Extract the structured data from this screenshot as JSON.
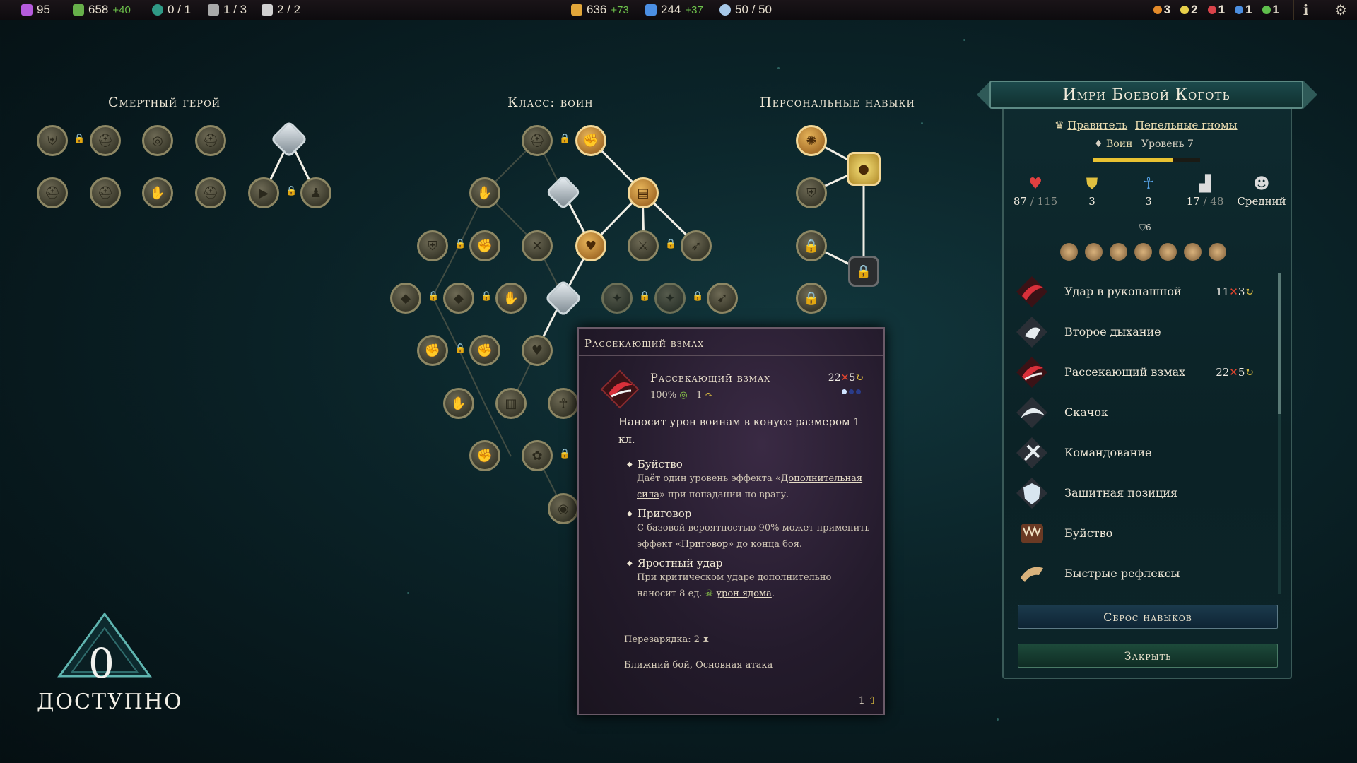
{
  "topbar": {
    "mana": "95",
    "gold_icon_a": "658",
    "gold_a_plus": "+40",
    "portals": "0 / 1",
    "cities": "1 / 3",
    "heroes": "2 / 2",
    "gold": "636",
    "gold_plus": "+73",
    "research": "244",
    "research_plus": "+37",
    "stability": "50 / 50",
    "affinities": [
      "3",
      "2",
      "1",
      "1",
      "1"
    ],
    "colors": {
      "mana": "#b55bdc",
      "food": "#67b04a",
      "gold": "#e3a73a",
      "research": "#4b8fe3",
      "stability": "#a6c8e8"
    }
  },
  "sections": {
    "mortal": "Смертный герой",
    "class": "Класс: воин",
    "personal": "Персональные навыки"
  },
  "available": {
    "count": "0",
    "label": "ДОСТУПНО"
  },
  "tooltip": {
    "header": "Рассекающий взмах",
    "name": "Рассекающий взмах",
    "damage": "22",
    "damage_mult": "5",
    "accuracy": "100%",
    "range": "1",
    "description": "Наносит урон воинам в конусе размером 1 кл.",
    "bullets": [
      {
        "title": "Буйство",
        "text_pre": "Даёт один уровень эффекта «",
        "link": "Дополнительная сила",
        "text_post": "» при попадании по врагу."
      },
      {
        "title": "Приговор",
        "text_pre": "С базовой вероятностью 90% может применить эффект «",
        "link": "Приговор",
        "text_post": "» до конца боя."
      },
      {
        "title": "Яростный удар",
        "text_pre": "При критическом ударе дополнительно наносит 8 ед. ",
        "link": "урон ядома",
        "text_post": "."
      }
    ],
    "cooldown": "Перезарядка: 2",
    "tags": "Ближний бой, Основная атака",
    "cost": "1"
  },
  "panel": {
    "hero_name": "Имри Боевой Коготь",
    "role": "Правитель",
    "race": "Пепельные гномы",
    "class": "Воин",
    "level": "Уровень 7",
    "xp_fraction": 0.75,
    "hp": "87",
    "hp_max": "/ 115",
    "defense": "3",
    "resistance": "3",
    "movement": "17",
    "movement_max": "/ 48",
    "morale": "Средний",
    "armor": "6",
    "skills": [
      {
        "name": "Удар в рукопашной",
        "dmg": "11",
        "mult": "3"
      },
      {
        "name": "Второе дыхание",
        "dmg": "",
        "mult": ""
      },
      {
        "name": "Рассекающий взмах",
        "dmg": "22",
        "mult": "5"
      },
      {
        "name": "Скачок",
        "dmg": "",
        "mult": ""
      },
      {
        "name": "Командование",
        "dmg": "",
        "mult": ""
      },
      {
        "name": "Защитная позиция",
        "dmg": "",
        "mult": ""
      },
      {
        "name": "Буйство",
        "dmg": "",
        "mult": ""
      },
      {
        "name": "Быстрые рефлексы",
        "dmg": "",
        "mult": ""
      }
    ],
    "reset_button": "Сброс навыков",
    "close_button": "Закрыть"
  }
}
